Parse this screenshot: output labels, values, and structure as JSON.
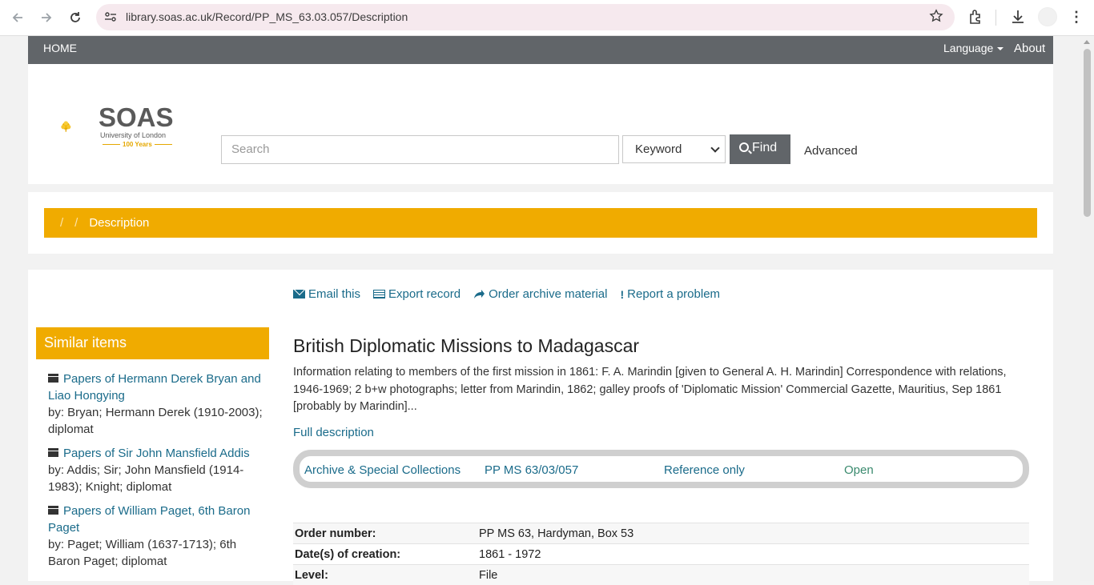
{
  "browser": {
    "url": "library.soas.ac.uk/Record/PP_MS_63.03.057/Description"
  },
  "topnav": {
    "home": "HOME",
    "language": "Language",
    "about": "About"
  },
  "logo": {
    "name": "SOAS",
    "subtitle": "University of London",
    "years": "100 Years"
  },
  "search": {
    "placeholder": "Search",
    "type_selected": "Keyword",
    "find_label": "Find",
    "advanced_label": "Advanced"
  },
  "breadcrumb": {
    "sep1": "/",
    "sep2": "/",
    "current": "Description"
  },
  "actions": {
    "email": "Email this",
    "export": "Export record",
    "order": "Order archive material",
    "report": "Report a problem"
  },
  "similar": {
    "heading": "Similar items",
    "items": [
      {
        "title": "Papers of Hermann Derek Bryan and Liao Hongying",
        "by": "by: Bryan; Hermann Derek (1910-2003); diplomat"
      },
      {
        "title": "Papers of Sir John Mansfield Addis",
        "by": "by: Addis; Sir; John Mansfield (1914-1983); Knight; diplomat"
      },
      {
        "title": "Papers of William Paget, 6th Baron Paget",
        "by": "by: Paget; William (1637-1713); 6th Baron Paget; diplomat"
      }
    ]
  },
  "record": {
    "title": "British Diplomatic Missions to Madagascar",
    "description": "Information relating to members of the first mission in 1861: F. A. Marindin [given to General A. H. Marindin] Correspondence with relations, 1946-1969; 2 b+w photographs; letter from Marindin, 1862; galley proofs of 'Diplomatic Mission' Commercial Gazette, Mauritius, Sep 1861 [probably by Marindin]...",
    "full_description": "Full description",
    "holdings": {
      "location": "Archive & Special Collections",
      "callnumber": "PP MS 63/03/057",
      "status": "Reference only",
      "availability": "Open"
    },
    "details": [
      {
        "key": "Order number:",
        "value": "PP MS 63, Hardyman, Box 53"
      },
      {
        "key": "Date(s) of creation:",
        "value": "1861 - 1972"
      },
      {
        "key": "Level:",
        "value": "File"
      }
    ]
  },
  "colors": {
    "accent": "#f0ab00",
    "nav": "#616569",
    "link": "#1a6b8a"
  }
}
